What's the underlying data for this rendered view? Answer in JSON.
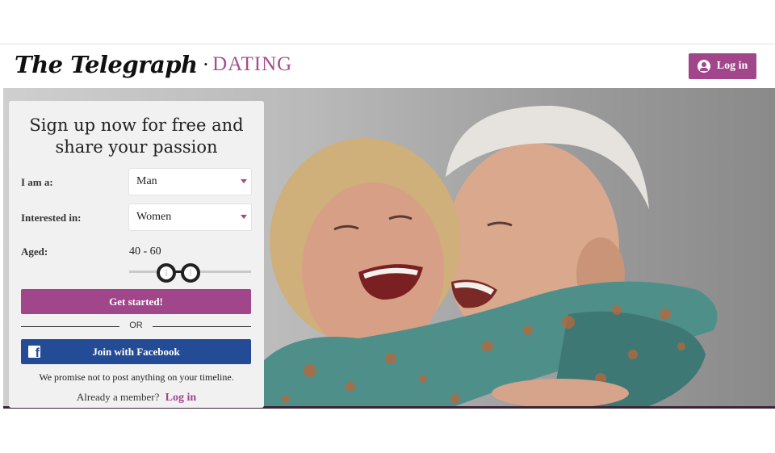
{
  "brand": {
    "name": "The Telegraph",
    "separator": "•",
    "product": "DATING"
  },
  "header": {
    "login_label": "Log in",
    "login_icon": "user-circle-icon"
  },
  "signup": {
    "headline_line1": "Sign up now for free and",
    "headline_line2": "share your passion",
    "i_am_label": "I am a:",
    "i_am_value": "Man",
    "interested_label": "Interested in:",
    "interested_value": "Women",
    "aged_label": "Aged:",
    "age_range_text": "40 - 60",
    "age_min": 40,
    "age_max": 60,
    "cta_label": "Get started!",
    "or_label": "OR",
    "facebook_label": "Join with Facebook",
    "facebook_icon": "facebook-icon",
    "promise_text": "We promise not to post anything on your timeline.",
    "member_text": "Already a member?",
    "member_link": "Log in"
  },
  "colors": {
    "accent": "#a2468b",
    "facebook": "#244c96",
    "footer_bar": "#3a2436"
  }
}
